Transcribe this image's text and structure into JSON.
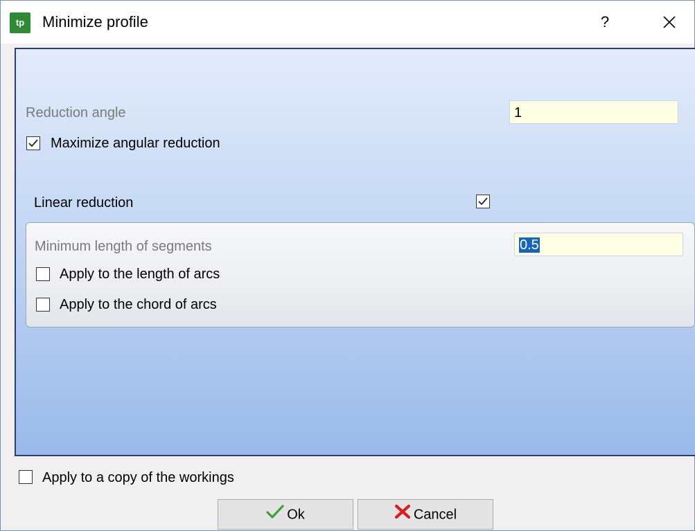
{
  "window": {
    "title": "Minimize profile",
    "help_label": "?",
    "close_label": "✕",
    "app_icon_text": "tp"
  },
  "angular": {
    "reduction_angle_label": "Reduction angle",
    "reduction_angle_value": "1",
    "maximize_label": "Maximize angular reduction",
    "maximize_checked": true
  },
  "linear": {
    "label": "Linear reduction",
    "checked": true,
    "min_length_label": "Minimum length of segments",
    "min_length_value": "0.5",
    "apply_length_arcs_label": "Apply to the length of arcs",
    "apply_length_arcs_checked": false,
    "apply_chord_arcs_label": "Apply to the chord of arcs",
    "apply_chord_arcs_checked": false
  },
  "footer": {
    "apply_copy_label": "Apply to a copy of the workings",
    "apply_copy_checked": false,
    "ok_label": "Ok",
    "cancel_label": "Cancel"
  }
}
